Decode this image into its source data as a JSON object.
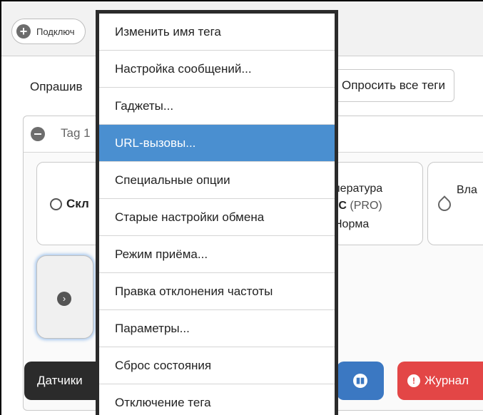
{
  "topbar": {
    "connect_label": "Подключ"
  },
  "poll": {
    "label": "Опрашив",
    "all_button": "Опросить все теги"
  },
  "tag": {
    "title": "Tag 1"
  },
  "cards": {
    "card1_label": "Скл",
    "temp_line1": "пература",
    "temp_value": "°C",
    "temp_pro": "(PRO)",
    "temp_status": "Норма",
    "card3_label": "Вла"
  },
  "buttons": {
    "sensors": "Датчики",
    "journal": "Журнал"
  },
  "menu": {
    "items": [
      "Изменить имя тега",
      "Настройка сообщений...",
      "Гаджеты...",
      "URL-вызовы...",
      "Специальные опции",
      "Старые настройки обмена",
      "Режим приёма...",
      "Правка отклонения частоты",
      "Параметры...",
      "Сброс состояния",
      "Отключение тега"
    ],
    "active_index": 3
  },
  "colors": {
    "accent": "#4a8fd0",
    "danger": "#e34646",
    "dark": "#2b2b2b"
  },
  "icons": [
    "plus-icon",
    "refresh-icon",
    "minus-icon",
    "bubble-icon",
    "drop-icon",
    "chevron-right-icon",
    "bar-chart-icon",
    "warning-icon"
  ]
}
